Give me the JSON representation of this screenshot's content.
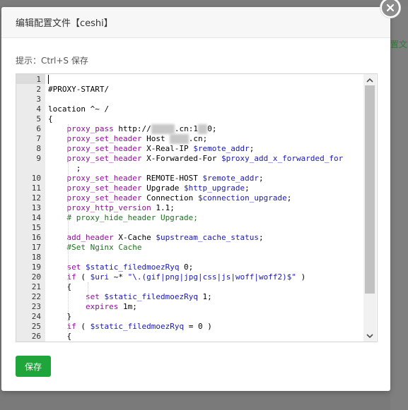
{
  "background": {
    "tab_text_fragment": "置文"
  },
  "dialog": {
    "title": "编辑配置文件【ceshi】",
    "hint": "提示：Ctrl+S 保存",
    "save_label": "保存",
    "colors": {
      "save_button": "#20a53a",
      "keyword": "#881391",
      "variable": "#1a1aa6",
      "comment": "#236e25"
    }
  },
  "editor": {
    "lines": [
      {
        "n": "1",
        "tokens": []
      },
      {
        "n": "2",
        "tokens": [
          {
            "t": "#PROXY-START/",
            "c": "default"
          }
        ]
      },
      {
        "n": "3",
        "tokens": []
      },
      {
        "n": "4",
        "tokens": [
          {
            "t": "location ^~ /",
            "c": "default"
          }
        ]
      },
      {
        "n": "5",
        "tokens": [
          {
            "t": "{",
            "c": "default"
          }
        ]
      },
      {
        "n": "6",
        "tokens": [
          {
            "t": "    proxy_pass",
            "c": "keyword"
          },
          {
            "t": " http://",
            "c": "default"
          },
          {
            "t": "y▒▒▒▒",
            "c": "blur"
          },
          {
            "t": ".cn:1",
            "c": "default"
          },
          {
            "t": "▒▒",
            "c": "blur"
          },
          {
            "t": "0;",
            "c": "default"
          }
        ]
      },
      {
        "n": "7",
        "tokens": [
          {
            "t": "    proxy_set_header",
            "c": "keyword"
          },
          {
            "t": " Host ",
            "c": "default"
          },
          {
            "t": "y▒▒▒",
            "c": "blur"
          },
          {
            "t": ".cn;",
            "c": "default"
          }
        ]
      },
      {
        "n": "8",
        "tokens": [
          {
            "t": "    proxy_set_header",
            "c": "keyword"
          },
          {
            "t": " X-Real-IP ",
            "c": "default"
          },
          {
            "t": "$remote_addr",
            "c": "variable"
          },
          {
            "t": ";",
            "c": "default"
          }
        ]
      },
      {
        "n": "9",
        "tokens": [
          {
            "t": "    proxy_set_header",
            "c": "keyword"
          },
          {
            "t": " X-Forwarded-For ",
            "c": "default"
          },
          {
            "t": "$proxy_add_x_forwarded_for",
            "c": "variable"
          }
        ]
      },
      {
        "n": "",
        "tokens": [
          {
            "t": "      ;",
            "c": "default"
          }
        ]
      },
      {
        "n": "10",
        "tokens": [
          {
            "t": "    proxy_set_header",
            "c": "keyword"
          },
          {
            "t": " REMOTE-HOST ",
            "c": "default"
          },
          {
            "t": "$remote_addr",
            "c": "variable"
          },
          {
            "t": ";",
            "c": "default"
          }
        ]
      },
      {
        "n": "11",
        "tokens": [
          {
            "t": "    proxy_set_header",
            "c": "keyword"
          },
          {
            "t": " Upgrade ",
            "c": "default"
          },
          {
            "t": "$http_upgrade",
            "c": "variable"
          },
          {
            "t": ";",
            "c": "default"
          }
        ]
      },
      {
        "n": "12",
        "tokens": [
          {
            "t": "    proxy_set_header",
            "c": "keyword"
          },
          {
            "t": " Connection ",
            "c": "default"
          },
          {
            "t": "$connection_upgrade",
            "c": "variable"
          },
          {
            "t": ";",
            "c": "default"
          }
        ]
      },
      {
        "n": "13",
        "tokens": [
          {
            "t": "    proxy_http_version",
            "c": "keyword"
          },
          {
            "t": " 1.1;",
            "c": "default"
          }
        ]
      },
      {
        "n": "14",
        "tokens": [
          {
            "t": "    # proxy_hide_header Upgrade;",
            "c": "comment"
          }
        ]
      },
      {
        "n": "15",
        "tokens": []
      },
      {
        "n": "16",
        "tokens": [
          {
            "t": "    add_header",
            "c": "keyword"
          },
          {
            "t": " X-Cache ",
            "c": "default"
          },
          {
            "t": "$upstream_cache_status",
            "c": "variable"
          },
          {
            "t": ";",
            "c": "default"
          }
        ]
      },
      {
        "n": "17",
        "tokens": [
          {
            "t": "    #Set Nginx Cache",
            "c": "comment"
          }
        ]
      },
      {
        "n": "18",
        "tokens": []
      },
      {
        "n": "19",
        "tokens": [
          {
            "t": "    set",
            "c": "keyword"
          },
          {
            "t": " ",
            "c": "default"
          },
          {
            "t": "$static_filedmoezRyq",
            "c": "variable"
          },
          {
            "t": " 0;",
            "c": "default"
          }
        ]
      },
      {
        "n": "20",
        "tokens": [
          {
            "t": "    if",
            "c": "keyword"
          },
          {
            "t": " ( ",
            "c": "default"
          },
          {
            "t": "$uri",
            "c": "variable"
          },
          {
            "t": " ~* ",
            "c": "default"
          },
          {
            "t": "\"\\.(gif|png|jpg|css|js|woff|woff2)$\"",
            "c": "string"
          },
          {
            "t": " )",
            "c": "default"
          }
        ]
      },
      {
        "n": "21",
        "tokens": [
          {
            "t": "    {",
            "c": "default"
          }
        ]
      },
      {
        "n": "22",
        "tokens": [
          {
            "t": "        set",
            "c": "keyword"
          },
          {
            "t": " ",
            "c": "default"
          },
          {
            "t": "$static_filedmoezRyq",
            "c": "variable"
          },
          {
            "t": " 1;",
            "c": "default"
          }
        ]
      },
      {
        "n": "23",
        "tokens": [
          {
            "t": "        expires",
            "c": "keyword"
          },
          {
            "t": " 1m;",
            "c": "default"
          }
        ]
      },
      {
        "n": "24",
        "tokens": [
          {
            "t": "    }",
            "c": "default"
          }
        ]
      },
      {
        "n": "25",
        "tokens": [
          {
            "t": "    if",
            "c": "keyword"
          },
          {
            "t": " ( ",
            "c": "default"
          },
          {
            "t": "$static_filedmoezRyq",
            "c": "variable"
          },
          {
            "t": " = 0 )",
            "c": "default"
          }
        ]
      },
      {
        "n": "26",
        "tokens": [
          {
            "t": "    {",
            "c": "default"
          }
        ]
      }
    ]
  }
}
